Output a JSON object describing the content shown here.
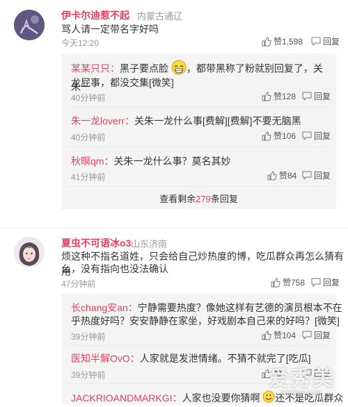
{
  "comment1": {
    "username": "伊卡尔迪惹不起",
    "location": "内蒙古通辽",
    "text": "骂人请一定带名字好吗",
    "time": "今天12:20",
    "likes": "赞1,598",
    "reply": "回复",
    "replies": [
      {
        "user": "某某只只：",
        "text_a": "黑子要点脸",
        "text_b": "，都带黑称了粉就别回复了，关朱一",
        "text_c": "龙屁事，都没交集[微笑]",
        "time": "40分钟前",
        "likes": "赞128",
        "reply": "回复"
      },
      {
        "user": "朱一龙loverr：",
        "text": "关朱一龙什么事[费解][费解]不要无脑黑",
        "time": "40分钟前",
        "likes": "赞106",
        "reply": "回复"
      },
      {
        "user": "秋暝qm：",
        "text": "关朱一龙什么事？莫名其妙",
        "time": "41分钟前",
        "likes": "赞84",
        "reply": "回复"
      }
    ],
    "more_prefix": "查看剩余",
    "more_count": "279",
    "more_suffix": "条回复"
  },
  "comment2": {
    "username": "夏虫不可语冰o3",
    "location": "山东济南",
    "text_line1": "烦这种不指名道姓，只会给自己炒热度的博，吃瓜群众再怎么猜有用",
    "text_line2": "么，没有指向也没法确认",
    "time": "47分钟前",
    "likes": "赞758",
    "reply": "回复",
    "replies": [
      {
        "user": "长chang安an：",
        "text_a": "宁静需要热度？像她这样有艺德的演员根本不在",
        "text_b": "乎热度好吗？安安静静在家坐，好戏剧本自己来的好吗？[微笑]",
        "time": "39分钟前",
        "likes": "赞104",
        "reply": "回复"
      },
      {
        "user": "医知半解OvO：",
        "text": "人家就是发泄情绪。不猜不就完了[吃瓜]",
        "time": "39分钟前",
        "likes": "赞",
        "reply": "回复"
      },
      {
        "user": "JACKRIOANDMARKGI：",
        "text_a": "人家也没要你猜啊",
        "text_b": "还不是吃瓜群众"
      }
    ]
  },
  "watermark": {
    "cn": "爱秀美",
    "en": "ixiumei.com"
  },
  "colors": {
    "accent": "#e5415d",
    "muted": "#999999",
    "reply_bg": "#f4f4f4"
  }
}
